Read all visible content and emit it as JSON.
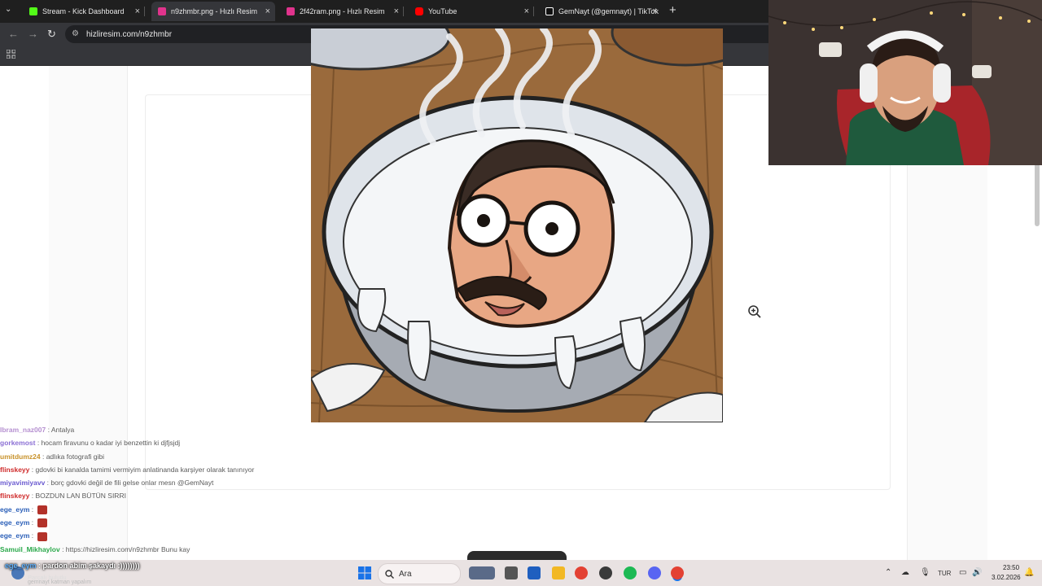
{
  "browser": {
    "tabs": [
      {
        "label": "Stream - Kick Dashboard",
        "favicon_color": "#53fc18",
        "active": false
      },
      {
        "label": "n9zhmbr.png - Hızlı Resim",
        "favicon_color": "#e0338c",
        "active": true
      },
      {
        "label": "2f42ram.png - Hızlı Resim",
        "favicon_color": "#e0338c",
        "active": false
      },
      {
        "label": "YouTube",
        "favicon_color": "#ff0000",
        "active": false
      },
      {
        "label": "GemNayt (@gemnayt) | TikTok",
        "favicon_color": "#ffffff",
        "active": false
      }
    ],
    "url": "hizliresim.com/n9zhmbr",
    "new_tab_glyph": "+",
    "close_glyph": "×"
  },
  "chat": {
    "messages": [
      {
        "user": "Ibram_naz007",
        "user_color": "#b58fd0",
        "text": "Antalya"
      },
      {
        "user": "gorkemost",
        "user_color": "#8b6fd4",
        "text": "hocam firavunu o kadar iyi benzettin ki djfjsjdj"
      },
      {
        "user": "umitdumz24",
        "user_color": "#c8922a",
        "text": "adlıka fotografi gibi"
      },
      {
        "user": "flinskeyy",
        "user_color": "#cf2b2b",
        "text": "gdovki bi kanalda tamimi vermiyim anlatinanda karşiyer olarak tanınıyor"
      },
      {
        "user": "miyavimiyavv",
        "user_color": "#6a5ad0",
        "text": "borç gdovki değil de fili gelse onlar mesn @GemNayt"
      },
      {
        "user": "flinskeyy",
        "user_color": "#cf2b2b",
        "text": "BOZDUN LAN BÜTÜN SIRRI"
      },
      {
        "user": "ege_eym",
        "user_color": "#2b5fb8",
        "text": "",
        "emote": true
      },
      {
        "user": "ege_eym",
        "user_color": "#2b5fb8",
        "text": "",
        "emote": true
      },
      {
        "user": "ege_eym",
        "user_color": "#2b5fb8",
        "text": "",
        "emote": true
      },
      {
        "user": "Samuil_Mikhaylov",
        "user_color": "#2aa84a",
        "text": "https://hizliresim.com/n9zhmbr Bunu kay"
      }
    ],
    "alert_user": "ege_eym",
    "alert_text": "pardon abim şakaydı :))))))))",
    "alert_sub": "Parçalı bulutlu",
    "alert_sub2": "gemnayt katman yapalım"
  },
  "taskbar": {
    "search_placeholder": "Ara",
    "lang": "TUR",
    "time": "23:50",
    "date": "3.02.2026"
  },
  "icons": {
    "zoom": "zoom-in-icon",
    "start": "windows-start-icon"
  }
}
